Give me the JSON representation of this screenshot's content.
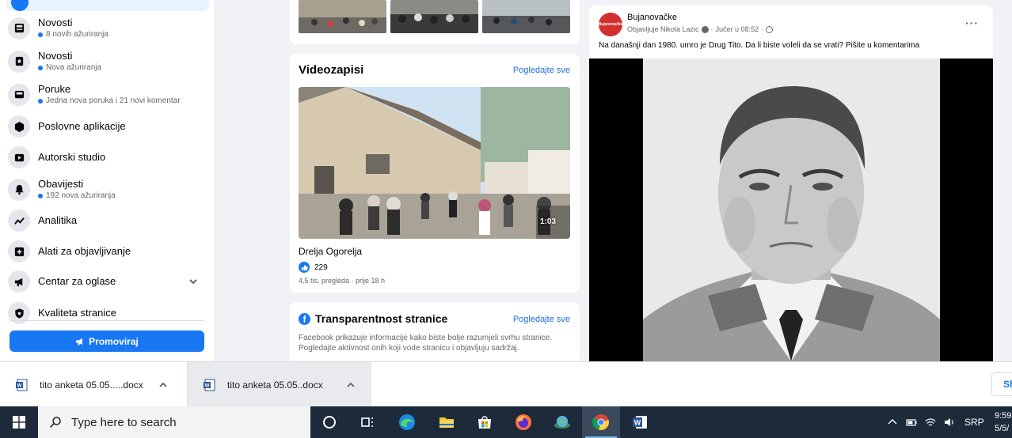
{
  "sidebar": {
    "items": [
      {
        "label": "Novosti",
        "sub": "8 novih ažuriranja",
        "icon": "news-feed-icon"
      },
      {
        "label": "Novosti",
        "sub": "Nova ažuriranja",
        "icon": "news-icon"
      },
      {
        "label": "Poruke",
        "sub": "Jedna nova poruka i 21 novi komentar",
        "icon": "inbox-icon"
      },
      {
        "label": "Poslovne aplikacije",
        "sub": "",
        "icon": "cube-icon"
      },
      {
        "label": "Autorski studio",
        "sub": "",
        "icon": "play-icon"
      },
      {
        "label": "Obavijesti",
        "sub": "192 nova ažuriranja",
        "icon": "bell-icon"
      },
      {
        "label": "Analitika",
        "sub": "",
        "icon": "chart-line-icon"
      },
      {
        "label": "Alati za objavljivanje",
        "sub": "",
        "icon": "publishing-tools-icon"
      },
      {
        "label": "Centar za oglase",
        "sub": "",
        "icon": "megaphone-icon"
      },
      {
        "label": "Kvaliteta stranice",
        "sub": "",
        "icon": "shield-icon"
      }
    ],
    "promote_label": "Promoviraj"
  },
  "videos": {
    "title": "Videozapisi",
    "see_all": "Pogledajte sve",
    "duration": "1:03",
    "name": "Drelja Ogorelja",
    "likes": "229",
    "meta": "4,5 tis. pregleda · prije 18 h"
  },
  "transparency": {
    "title": "Transparentnost stranice",
    "see_all": "Pogledajte sve",
    "description": "Facebook prikazuje informacije kako biste bolje razumjeli svrhu stranice. Pogledajte aktivnost onih koji vode stranicu i objavljuju sadržaj."
  },
  "post": {
    "author": "Bujanovačke",
    "avatar_text": "Bujanovačke",
    "byline_prefix": "Objavljuje Nikola Lazic",
    "time": "Jučer u 08:52",
    "more": "···",
    "text": "Na današnji dan 1980. umro je Drug Tito. Da li biste voleli da se vrati? Pišite u komentarima"
  },
  "downloads": {
    "items": [
      {
        "name": "tito anketa 05.05.....docx"
      },
      {
        "name": "tito anketa 05.05..docx"
      }
    ],
    "show_all": "Sh"
  },
  "taskbar": {
    "search_placeholder": "Type here to search",
    "language": "SRP",
    "time": "9:59",
    "date": "5/5/"
  },
  "colors": {
    "fb_blue": "#1877f2",
    "sidebar_bg": "#ffffff",
    "page_bg": "#f0f2f5",
    "taskbar_bg": "#1c2a3a"
  }
}
